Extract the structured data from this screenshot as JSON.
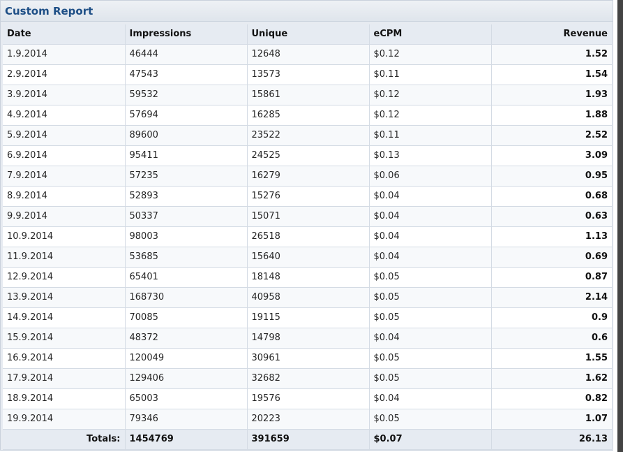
{
  "report": {
    "title": "Custom Report"
  },
  "table": {
    "headers": {
      "date": "Date",
      "impressions": "Impressions",
      "unique": "Unique",
      "ecpm": "eCPM",
      "revenue": "Revenue"
    },
    "rows": [
      {
        "date": "1.9.2014",
        "impressions": "46444",
        "unique": "12648",
        "ecpm": "$0.12",
        "revenue": "1.52"
      },
      {
        "date": "2.9.2014",
        "impressions": "47543",
        "unique": "13573",
        "ecpm": "$0.11",
        "revenue": "1.54"
      },
      {
        "date": "3.9.2014",
        "impressions": "59532",
        "unique": "15861",
        "ecpm": "$0.12",
        "revenue": "1.93"
      },
      {
        "date": "4.9.2014",
        "impressions": "57694",
        "unique": "16285",
        "ecpm": "$0.12",
        "revenue": "1.88"
      },
      {
        "date": "5.9.2014",
        "impressions": "89600",
        "unique": "23522",
        "ecpm": "$0.11",
        "revenue": "2.52"
      },
      {
        "date": "6.9.2014",
        "impressions": "95411",
        "unique": "24525",
        "ecpm": "$0.13",
        "revenue": "3.09"
      },
      {
        "date": "7.9.2014",
        "impressions": "57235",
        "unique": "16279",
        "ecpm": "$0.06",
        "revenue": "0.95"
      },
      {
        "date": "8.9.2014",
        "impressions": "52893",
        "unique": "15276",
        "ecpm": "$0.04",
        "revenue": "0.68"
      },
      {
        "date": "9.9.2014",
        "impressions": "50337",
        "unique": "15071",
        "ecpm": "$0.04",
        "revenue": "0.63"
      },
      {
        "date": "10.9.2014",
        "impressions": "98003",
        "unique": "26518",
        "ecpm": "$0.04",
        "revenue": "1.13"
      },
      {
        "date": "11.9.2014",
        "impressions": "53685",
        "unique": "15640",
        "ecpm": "$0.04",
        "revenue": "0.69"
      },
      {
        "date": "12.9.2014",
        "impressions": "65401",
        "unique": "18148",
        "ecpm": "$0.05",
        "revenue": "0.87"
      },
      {
        "date": "13.9.2014",
        "impressions": "168730",
        "unique": "40958",
        "ecpm": "$0.05",
        "revenue": "2.14"
      },
      {
        "date": "14.9.2014",
        "impressions": "70085",
        "unique": "19115",
        "ecpm": "$0.05",
        "revenue": "0.9"
      },
      {
        "date": "15.9.2014",
        "impressions": "48372",
        "unique": "14798",
        "ecpm": "$0.04",
        "revenue": "0.6"
      },
      {
        "date": "16.9.2014",
        "impressions": "120049",
        "unique": "30961",
        "ecpm": "$0.05",
        "revenue": "1.55"
      },
      {
        "date": "17.9.2014",
        "impressions": "129406",
        "unique": "32682",
        "ecpm": "$0.05",
        "revenue": "1.62"
      },
      {
        "date": "18.9.2014",
        "impressions": "65003",
        "unique": "19576",
        "ecpm": "$0.04",
        "revenue": "0.82"
      },
      {
        "date": "19.9.2014",
        "impressions": "79346",
        "unique": "20223",
        "ecpm": "$0.05",
        "revenue": "1.07"
      }
    ],
    "totals": {
      "label": "Totals:",
      "impressions": "1454769",
      "unique": "391659",
      "ecpm": "$0.07",
      "revenue": "26.13"
    }
  },
  "colors": {
    "title": "#1e4f86",
    "panel_background": "#e7ebf1",
    "header_row": "#e6ebf2",
    "row_alt": "#f7f9fb"
  }
}
